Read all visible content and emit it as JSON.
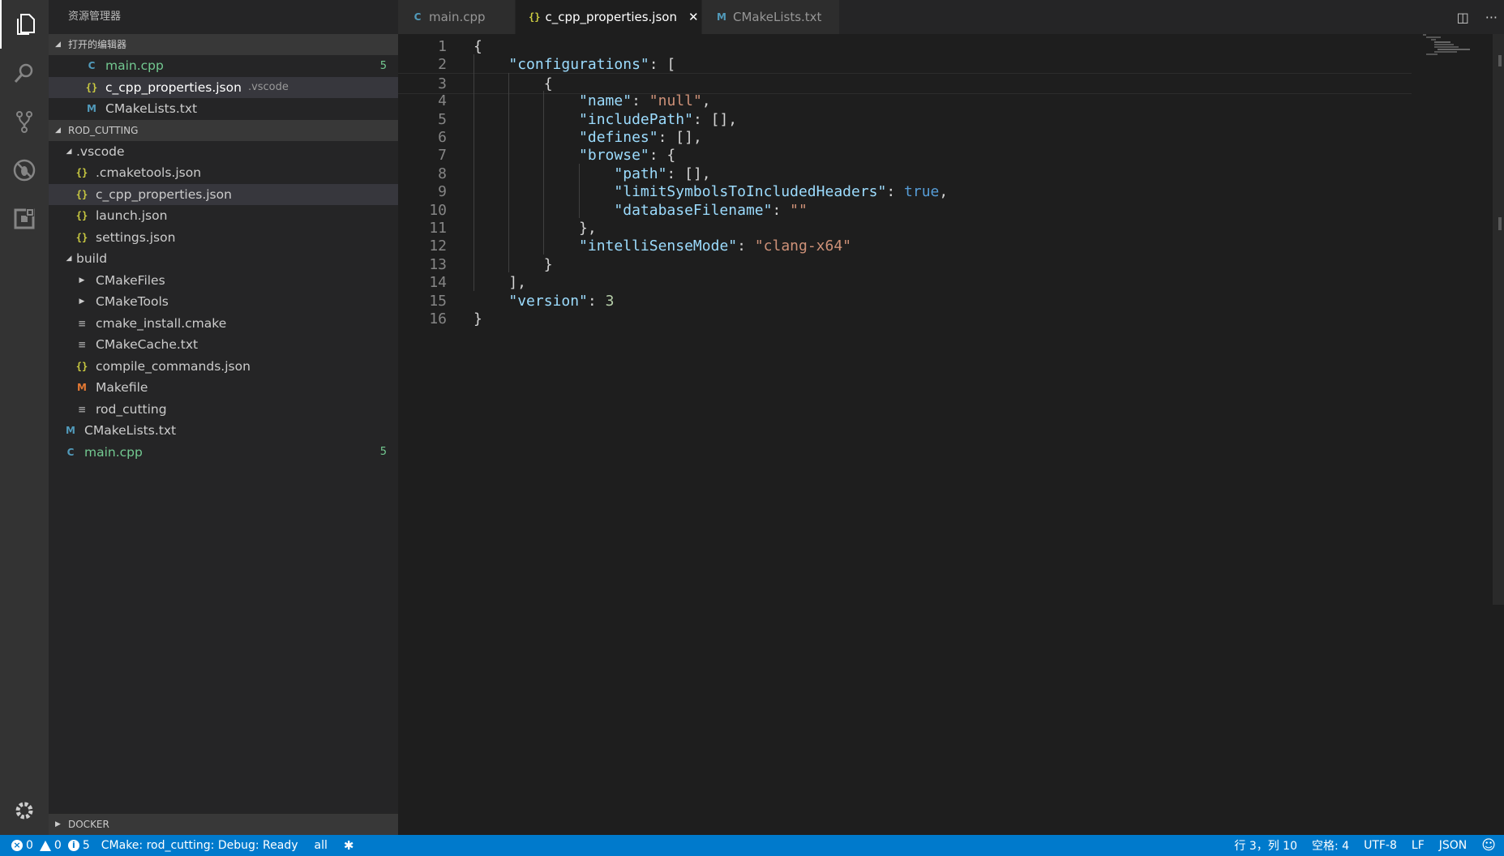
{
  "sidebar": {
    "title": "资源管理器",
    "open_editors": {
      "header": "打开的编辑器",
      "items": [
        {
          "name": "main.cpp",
          "type": "cpp",
          "hint": "",
          "badge": "5",
          "modified": true
        },
        {
          "name": "c_cpp_properties.json",
          "type": "json",
          "hint": ".vscode",
          "badge": "",
          "modified": false
        },
        {
          "name": "CMakeLists.txt",
          "type": "cmake",
          "hint": "",
          "badge": "",
          "modified": false
        }
      ]
    },
    "project": {
      "header": "ROD_CUTTING",
      "items": [
        {
          "name": ".vscode",
          "type": "folder-open",
          "depth": 1
        },
        {
          "name": ".cmaketools.json",
          "type": "json",
          "depth": 2
        },
        {
          "name": "c_cpp_properties.json",
          "type": "json",
          "depth": 2
        },
        {
          "name": "launch.json",
          "type": "json",
          "depth": 2
        },
        {
          "name": "settings.json",
          "type": "json",
          "depth": 2
        },
        {
          "name": "build",
          "type": "folder-open",
          "depth": 1
        },
        {
          "name": "CMakeFiles",
          "type": "folder-closed",
          "depth": 2
        },
        {
          "name": "CMakeTools",
          "type": "folder-closed",
          "depth": 2
        },
        {
          "name": "cmake_install.cmake",
          "type": "txt",
          "depth": 2
        },
        {
          "name": "CMakeCache.txt",
          "type": "txt",
          "depth": 2
        },
        {
          "name": "compile_commands.json",
          "type": "json",
          "depth": 2
        },
        {
          "name": "Makefile",
          "type": "make",
          "depth": 2
        },
        {
          "name": "rod_cutting",
          "type": "txt",
          "depth": 2
        },
        {
          "name": "CMakeLists.txt",
          "type": "cmake",
          "depth": 1
        },
        {
          "name": "main.cpp",
          "type": "cpp",
          "depth": 1,
          "badge": "5"
        }
      ]
    },
    "docker": {
      "header": "DOCKER"
    }
  },
  "tabs": [
    {
      "label": "main.cpp",
      "type": "cpp",
      "active": false
    },
    {
      "label": "c_cpp_properties.json",
      "type": "json",
      "active": true
    },
    {
      "label": "CMakeLists.txt",
      "type": "cmake",
      "active": false
    }
  ],
  "editor": {
    "lines": [
      "{",
      "    \"configurations\": [",
      "        {",
      "            \"name\": \"null\",",
      "            \"includePath\": [],",
      "            \"defines\": [],",
      "            \"browse\": {",
      "                \"path\": [],",
      "                \"limitSymbolsToIncludedHeaders\": true,",
      "                \"databaseFilename\": \"\"",
      "            },",
      "            \"intelliSenseMode\": \"clang-x64\"",
      "        }",
      "    ],",
      "    \"version\": 3",
      "}"
    ],
    "current_line": 3
  },
  "statusbar": {
    "errors": "0",
    "warnings": "0",
    "infos": "5",
    "cmake_status": "CMake: rod_cutting: Debug: Ready",
    "target": "all",
    "position": "行 3，列 10",
    "spaces": "空格: 4",
    "encoding": "UTF-8",
    "eol": "LF",
    "language": "JSON"
  },
  "colors": {
    "accent": "#007acc",
    "json_icon": "#cbcb41",
    "cpp_icon": "#519aba",
    "make_icon": "#e37933",
    "modified": "#73c991"
  }
}
